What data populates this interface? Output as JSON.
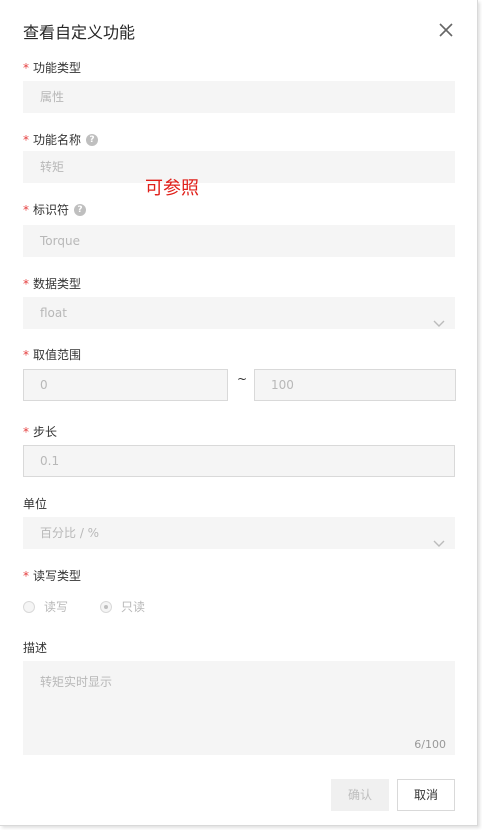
{
  "dialog": {
    "title": "查看自定义功能",
    "close_icon": "close-icon"
  },
  "overlay_note": "可参照",
  "form": {
    "function_type": {
      "label": "功能类型",
      "value": "属性"
    },
    "function_name": {
      "label": "功能名称",
      "value": "转矩"
    },
    "identifier": {
      "label": "标识符",
      "value": "Torque"
    },
    "data_type": {
      "label": "数据类型",
      "value": "float"
    },
    "value_range": {
      "label": "取值范围",
      "min": "0",
      "separator": "~",
      "max": "100"
    },
    "step": {
      "label": "步长",
      "value": "0.1"
    },
    "unit": {
      "label": "单位",
      "value": "百分比 / %"
    },
    "rw_type": {
      "label": "读写类型",
      "options": [
        "读写",
        "只读"
      ],
      "selected": "只读"
    },
    "description": {
      "label": "描述",
      "value": "转矩实时显示",
      "counter": "6/100"
    }
  },
  "footer": {
    "confirm_label": "确认",
    "cancel_label": "取消"
  },
  "colors": {
    "required": "#e53e3e",
    "note": "#e0201a",
    "disabled_bg": "#f5f5f5",
    "disabled_text": "#b8b8b8"
  }
}
